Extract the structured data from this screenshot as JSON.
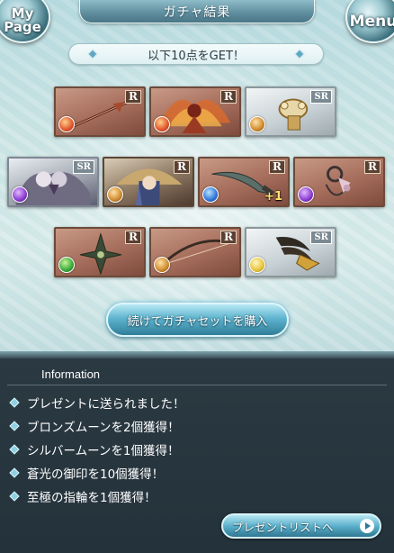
{
  "header": {
    "title": "ガチャ結果",
    "mypage_label": "My Page",
    "menu_label": "Menu"
  },
  "banner": {
    "text": "以下10点をGET！"
  },
  "items": [
    {
      "rarity": "R",
      "element": "fire",
      "icon": "spear-icon",
      "bonus": ""
    },
    {
      "rarity": "R",
      "element": "fire",
      "icon": "winged-character-icon",
      "bonus": ""
    },
    {
      "rarity": "SR",
      "element": "earth",
      "icon": "gauntlet-icon",
      "bonus": ""
    },
    {
      "rarity": "SR",
      "element": "dark",
      "icon": "dragon-character-icon",
      "bonus": ""
    },
    {
      "rarity": "R",
      "element": "earth",
      "icon": "witch-character-icon",
      "bonus": ""
    },
    {
      "rarity": "R",
      "element": "water",
      "icon": "dagger-icon",
      "bonus": "+1"
    },
    {
      "rarity": "R",
      "element": "dark",
      "icon": "flail-icon",
      "bonus": ""
    },
    {
      "rarity": "R",
      "element": "wind",
      "icon": "shuriken-icon",
      "bonus": ""
    },
    {
      "rarity": "R",
      "element": "earth",
      "icon": "bow-icon",
      "bonus": ""
    },
    {
      "rarity": "SR",
      "element": "light",
      "icon": "claw-icon",
      "bonus": ""
    }
  ],
  "buy_button": {
    "label": "続けてガチャセットを購入"
  },
  "information": {
    "title": "Information",
    "messages": [
      "プレゼントに送られました！",
      "ブロンズムーンを2個獲得！",
      "シルバームーンを1個獲得！",
      "蒼光の御印を10個獲得！",
      "至極の指輪を1個獲得！"
    ],
    "present_button_label": "プレゼントリストへ"
  },
  "colors": {
    "accent": "#5fb4cf",
    "panel_bg": "#2b3942",
    "stage_bg": "#cfe6e6"
  }
}
